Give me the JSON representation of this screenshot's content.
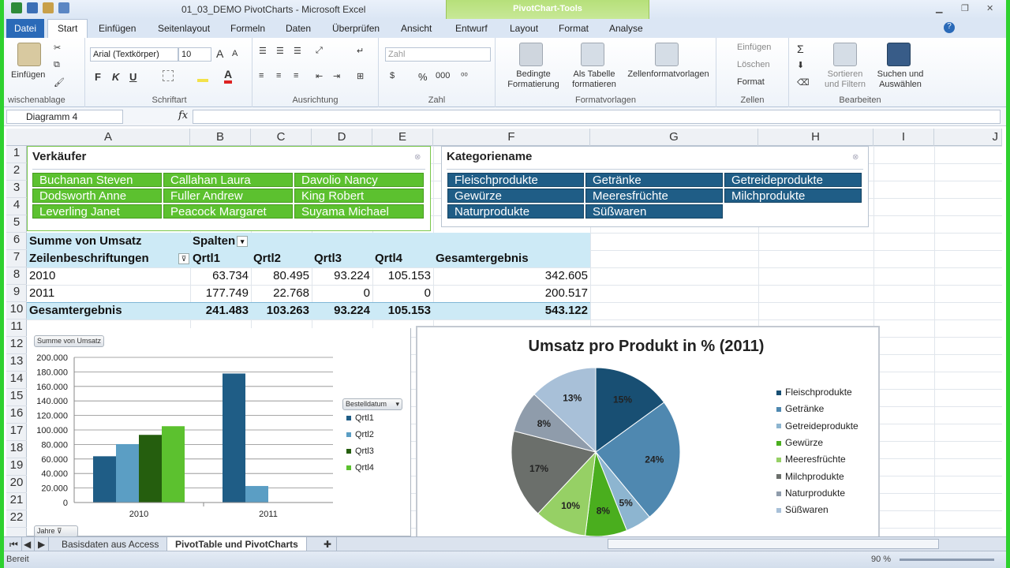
{
  "window": {
    "title": "01_03_DEMO PivotCharts - Microsoft Excel",
    "context_tools_label": "PivotChart-Tools"
  },
  "tabs": {
    "file": "Datei",
    "items": [
      "Start",
      "Einfügen",
      "Seitenlayout",
      "Formeln",
      "Daten",
      "Überprüfen",
      "Ansicht"
    ],
    "context_items": [
      "Entwurf",
      "Layout",
      "Format",
      "Analyse"
    ],
    "active": "Start"
  },
  "ribbon": {
    "clipboard": {
      "paste": "Einfügen",
      "label": "wischenablage"
    },
    "font": {
      "name": "Arial (Textkörper)",
      "size": "10",
      "bold": "F",
      "italic": "K",
      "underline": "U",
      "label": "Schriftart"
    },
    "alignment": {
      "label": "Ausrichtung"
    },
    "number": {
      "format": "Zahl",
      "percent": "%",
      "thousands": "000",
      "label": "Zahl"
    },
    "styles": {
      "conditional_line1": "Bedingte",
      "conditional_line2": "Formatierung",
      "as_table_line1": "Als Tabelle",
      "as_table_line2": "formatieren",
      "cell_styles": "Zellenformatvorlagen",
      "label": "Formatvorlagen"
    },
    "cells": {
      "insert": "Einfügen",
      "delete": "Löschen",
      "format": "Format",
      "label": "Zellen"
    },
    "editing": {
      "sort_line1": "Sortieren",
      "sort_line2": "und Filtern",
      "find_line1": "Suchen und",
      "find_line2": "Auswählen",
      "label": "Bearbeiten"
    }
  },
  "formula_bar": {
    "name_box": "Diagramm 4",
    "fx": "fx",
    "value": ""
  },
  "columns": [
    "A",
    "B",
    "C",
    "D",
    "E",
    "F",
    "G",
    "H",
    "I",
    "J"
  ],
  "rows": [
    "1",
    "2",
    "3",
    "4",
    "5",
    "6",
    "7",
    "8",
    "9",
    "10",
    "11",
    "12",
    "13",
    "14",
    "15",
    "16",
    "17",
    "18",
    "19",
    "20",
    "21",
    "22"
  ],
  "slicer_sellers": {
    "title": "Verkäufer",
    "items": [
      "Buchanan Steven",
      "Callahan Laura",
      "Davolio Nancy",
      "Dodsworth Anne",
      "Fuller Andrew",
      "King Robert",
      "Leverling Janet",
      "Peacock Margaret",
      "Suyama Michael"
    ]
  },
  "slicer_categories": {
    "title": "Kategoriename",
    "items": [
      "Fleischprodukte",
      "Getränke",
      "Getreideprodukte",
      "Gewürze",
      "Meeresfrüchte",
      "Milchprodukte",
      "Naturprodukte",
      "Süßwaren"
    ]
  },
  "pivot": {
    "value_field": "Summe von Umsatz",
    "column_label": "Spalten",
    "row_label": "Zeilenbeschriftungen",
    "headers": [
      "Qrtl1",
      "Qrtl2",
      "Qrtl3",
      "Qrtl4",
      "Gesamtergebnis"
    ],
    "rows": [
      {
        "label": "2010",
        "values": [
          "63.734",
          "80.495",
          "93.224",
          "105.153",
          "342.605"
        ]
      },
      {
        "label": "2011",
        "values": [
          "177.749",
          "22.768",
          "0",
          "0",
          "200.517"
        ]
      }
    ],
    "total": {
      "label": "Gesamtergebnis",
      "values": [
        "241.483",
        "103.263",
        "93.224",
        "105.153",
        "543.122"
      ]
    }
  },
  "chart_data": [
    {
      "type": "bar",
      "title": "",
      "field_button": "Summe von Umsatz",
      "legend_field": "Bestelldatum",
      "axis_field": "Jahre",
      "categories": [
        "2010",
        "2011"
      ],
      "series": [
        {
          "name": "Qrtl1",
          "values": [
            63734,
            177749
          ],
          "color": "#1f5d86"
        },
        {
          "name": "Qrtl2",
          "values": [
            80495,
            22768
          ],
          "color": "#5b9ec4"
        },
        {
          "name": "Qrtl3",
          "values": [
            93224,
            0
          ],
          "color": "#255e0e"
        },
        {
          "name": "Qrtl4",
          "values": [
            105153,
            0
          ],
          "color": "#5cc12f"
        }
      ],
      "ylim": [
        0,
        200000
      ],
      "yticks": [
        "0",
        "20.000",
        "40.000",
        "60.000",
        "80.000",
        "100.000",
        "120.000",
        "140.000",
        "160.000",
        "180.000",
        "200.000"
      ],
      "grid": true,
      "legend_position": "right"
    },
    {
      "type": "pie",
      "title": "Umsatz pro Produkt in % (2011)",
      "slices": [
        {
          "name": "Fleischprodukte",
          "value": 15,
          "label": "15%",
          "color": "#184f73"
        },
        {
          "name": "Getränke",
          "value": 24,
          "label": "24%",
          "color": "#4f88b0"
        },
        {
          "name": "Getreideprodukte",
          "value": 5,
          "label": "5%",
          "color": "#8db5d0"
        },
        {
          "name": "Gewürze",
          "value": 8,
          "label": "8%",
          "color": "#4aae1e"
        },
        {
          "name": "Meeresfrüchte",
          "value": 10,
          "label": "10%",
          "color": "#96d065"
        },
        {
          "name": "Milchprodukte",
          "value": 17,
          "label": "17%",
          "color": "#6b6f6b"
        },
        {
          "name": "Naturprodukte",
          "value": 8,
          "label": "8%",
          "color": "#8f9cab"
        },
        {
          "name": "Süßwaren",
          "value": 13,
          "label": "13%",
          "color": "#a8c0d8"
        }
      ],
      "legend_position": "right"
    }
  ],
  "sheets": {
    "items": [
      "Basisdaten aus Access",
      "PivotTable und PivotCharts"
    ],
    "active": "PivotTable und PivotCharts"
  },
  "status": {
    "mode": "Bereit",
    "zoom": "90 %"
  }
}
